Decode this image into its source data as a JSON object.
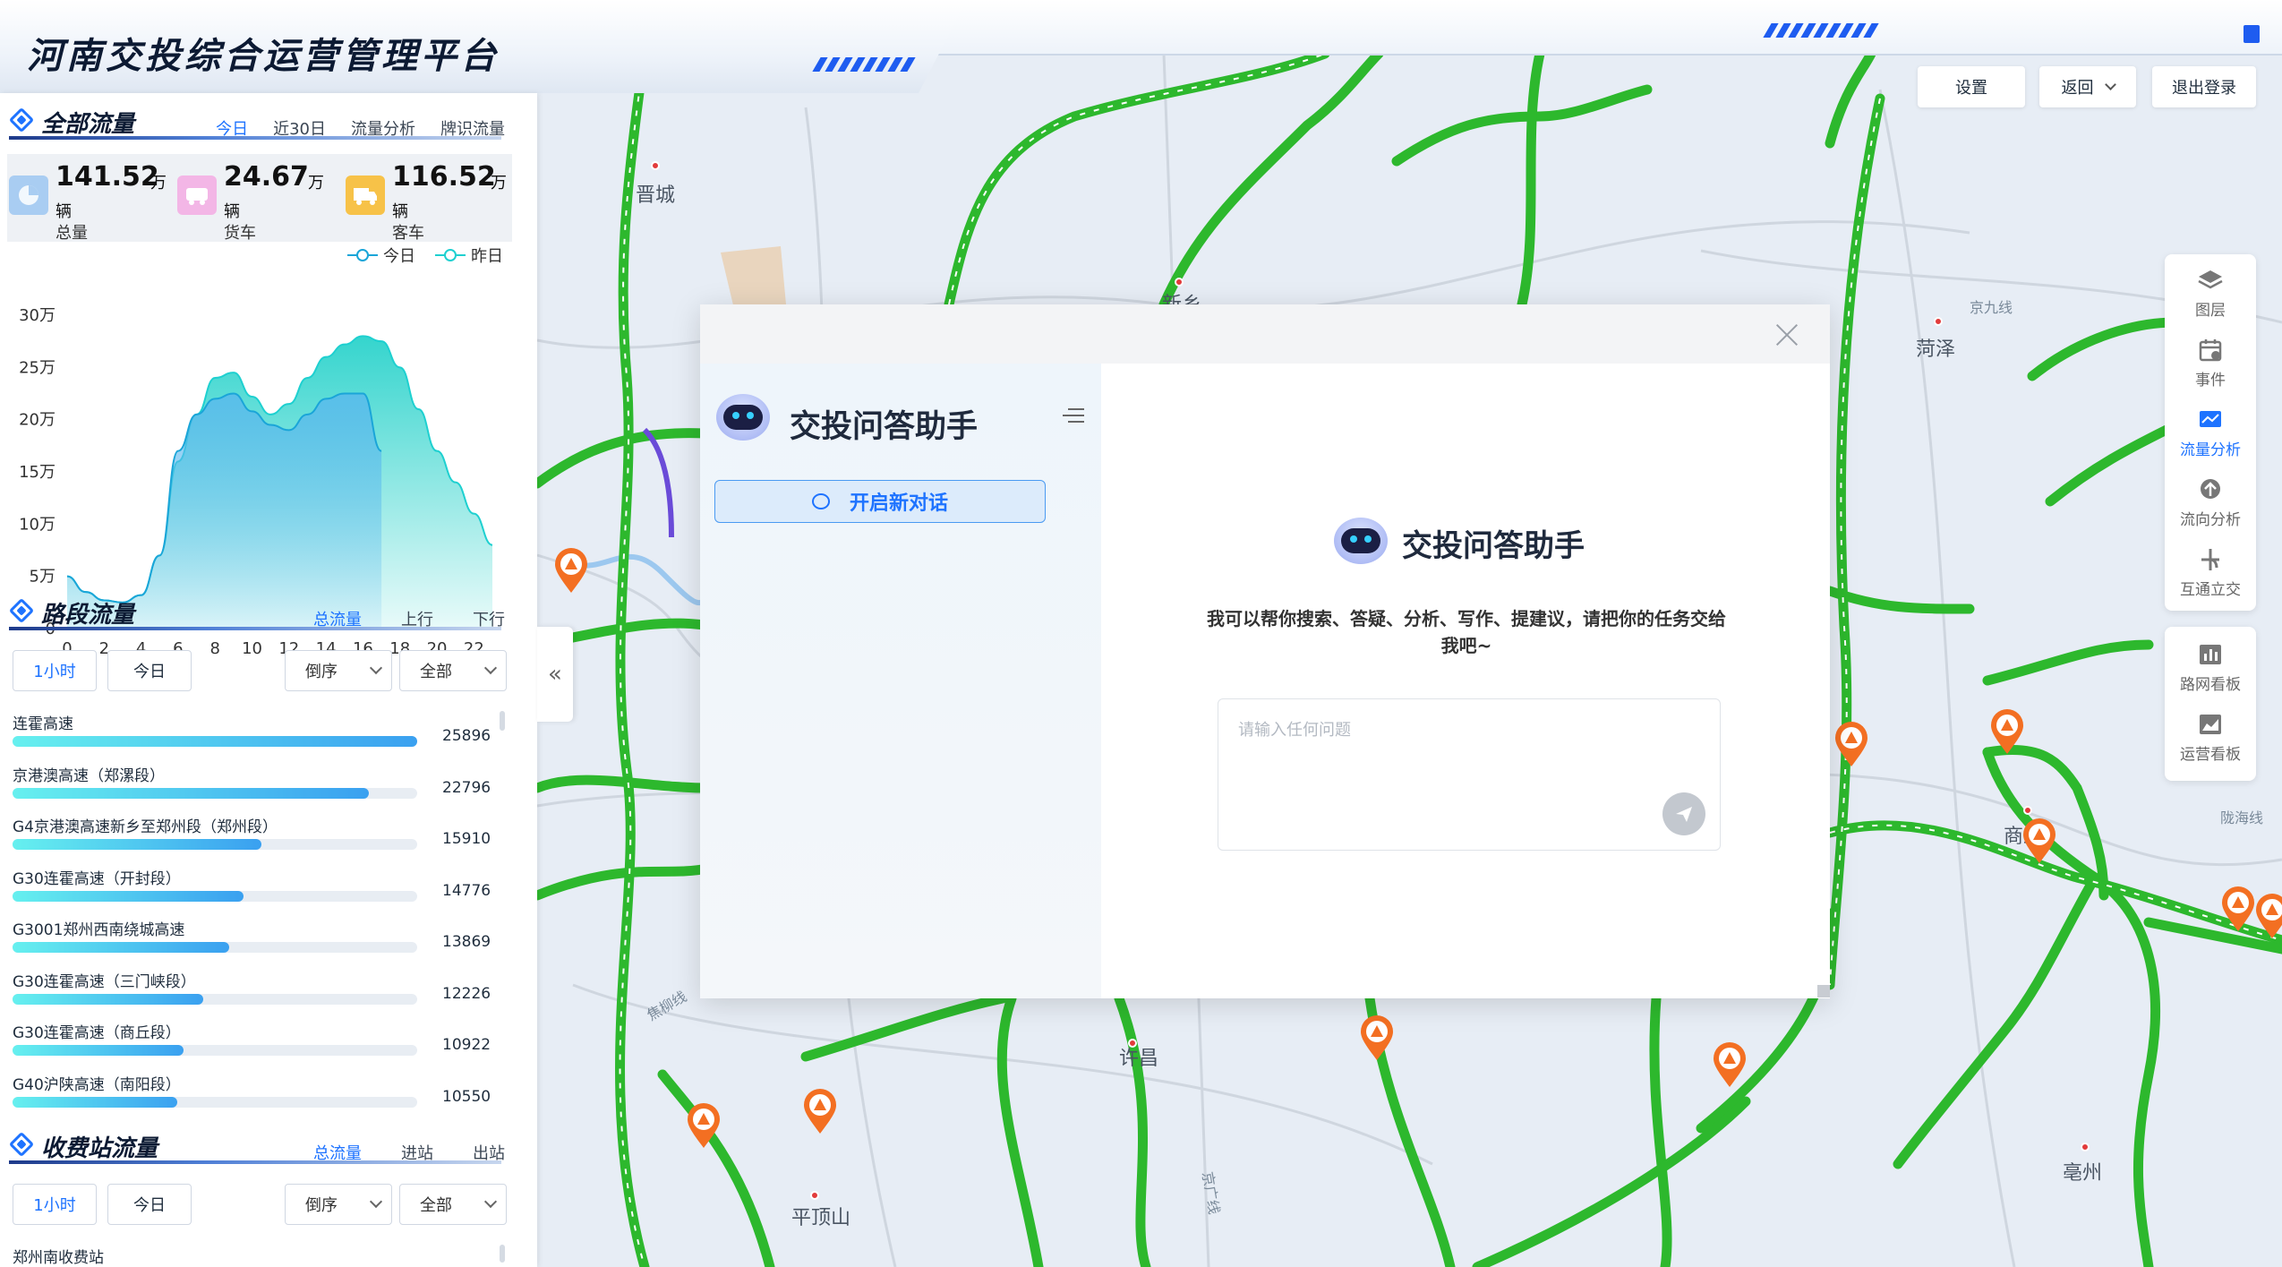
{
  "header": {
    "title": "河南交投综合运营管理平台",
    "buttons": {
      "settings": "设置",
      "back": "返回",
      "logout": "退出登录"
    }
  },
  "total_flow": {
    "title": "全部流量",
    "tabs": [
      "今日",
      "近30日",
      "流量分析",
      "牌识流量"
    ],
    "active_tab": "今日",
    "stats": [
      {
        "value": "141.52",
        "unit": "万",
        "unit2": "辆",
        "label": "总量",
        "icon": "pie-chart-icon",
        "color": "#a9cdf2"
      },
      {
        "value": "24.67",
        "unit": "万",
        "unit2": "辆",
        "label": "货车",
        "icon": "bus-icon",
        "color": "#f3b6e6"
      },
      {
        "value": "116.52",
        "unit": "万",
        "unit2": "辆",
        "label": "客车",
        "icon": "truck-icon",
        "color": "#f7c248"
      }
    ],
    "legend": [
      "今日",
      "昨日"
    ]
  },
  "chart_data": {
    "type": "area",
    "title": "",
    "xlabel": "",
    "ylabel": "",
    "x": [
      0,
      1,
      2,
      3,
      4,
      5,
      6,
      7,
      8,
      9,
      10,
      11,
      12,
      13,
      14,
      15,
      16,
      17,
      18,
      19,
      20,
      21,
      22,
      23
    ],
    "x_ticks": [
      0,
      2,
      4,
      6,
      8,
      10,
      12,
      14,
      16,
      18,
      20,
      22
    ],
    "y_ticks": [
      "0",
      "5万",
      "10万",
      "15万",
      "20万",
      "25万",
      "30万"
    ],
    "ylim": [
      0,
      300000
    ],
    "grid": false,
    "legend_position": "top-right",
    "series": [
      {
        "name": "今日",
        "color": "#1aa5d8",
        "values": [
          50000,
          35000,
          27000,
          25000,
          32000,
          70000,
          170000,
          205000,
          220000,
          225000,
          208000,
          195000,
          190000,
          205000,
          220000,
          225000,
          225000,
          170000
        ]
      },
      {
        "name": "昨日",
        "color": "#1ed0d0",
        "values": [
          50000,
          35000,
          27000,
          25000,
          32000,
          70000,
          160000,
          205000,
          240000,
          245000,
          222000,
          205000,
          215000,
          240000,
          260000,
          272000,
          280000,
          275000,
          250000,
          210000,
          170000,
          140000,
          110000,
          80000
        ]
      }
    ]
  },
  "road_flow": {
    "title": "路段流量",
    "tabs": [
      "总流量",
      "上行",
      "下行"
    ],
    "active_tab": "总流量",
    "time_buttons": [
      "1小时",
      "今日"
    ],
    "order_select": "倒序",
    "filter_select": "全部",
    "max": 25896,
    "items": [
      {
        "name": "连霍高速",
        "value": 25896
      },
      {
        "name": "京港澳高速（郑漯段）",
        "value": 22796
      },
      {
        "name": "G4京港澳高速新乡至郑州段（郑州段）",
        "value": 15910
      },
      {
        "name": "G30连霍高速（开封段）",
        "value": 14776
      },
      {
        "name": "G3001郑州西南绕城高速",
        "value": 13869
      },
      {
        "name": "G30连霍高速（三门峡段）",
        "value": 12226
      },
      {
        "name": "G30连霍高速（商丘段）",
        "value": 10922
      },
      {
        "name": "G40沪陕高速（南阳段）",
        "value": 10550
      }
    ]
  },
  "toll_flow": {
    "title": "收费站流量",
    "tabs": [
      "总流量",
      "进站",
      "出站"
    ],
    "active_tab": "总流量",
    "time_buttons": [
      "1小时",
      "今日"
    ],
    "order_select": "倒序",
    "filter_select": "全部",
    "first_item": "郑州南收费站"
  },
  "toolbar": {
    "group1": [
      {
        "label": "图层",
        "icon": "layers-icon",
        "active": false
      },
      {
        "label": "事件",
        "icon": "calendar-icon",
        "active": false
      },
      {
        "label": "流量分析",
        "icon": "line-chart-icon",
        "active": true
      },
      {
        "label": "流向分析",
        "icon": "flow-direction-icon",
        "active": false
      },
      {
        "label": "互通立交",
        "icon": "interchange-icon",
        "active": false
      }
    ],
    "group2": [
      {
        "label": "路网看板",
        "icon": "bar-chart-icon",
        "active": false
      },
      {
        "label": "运营看板",
        "icon": "area-chart-icon",
        "active": false
      }
    ]
  },
  "map": {
    "cities": [
      "晋城",
      "新乡",
      "菏泽",
      "许昌",
      "平顶山",
      "商丘",
      "亳州"
    ],
    "road_labels": [
      "京九线",
      "陇海线",
      "焦柳线",
      "京广线"
    ],
    "colors": {
      "road": "#2db82d",
      "road_alt": "#6a4bd8",
      "pin": "#f36f22"
    }
  },
  "assistant": {
    "title": "交投问答助手",
    "new_chat": "开启新对话",
    "welcome_title": "交投问答助手",
    "description": "我可以帮你搜索、答疑、分析、写作、提建议，请把你的任务交给我吧~",
    "input_placeholder": "请输入任何问题"
  }
}
